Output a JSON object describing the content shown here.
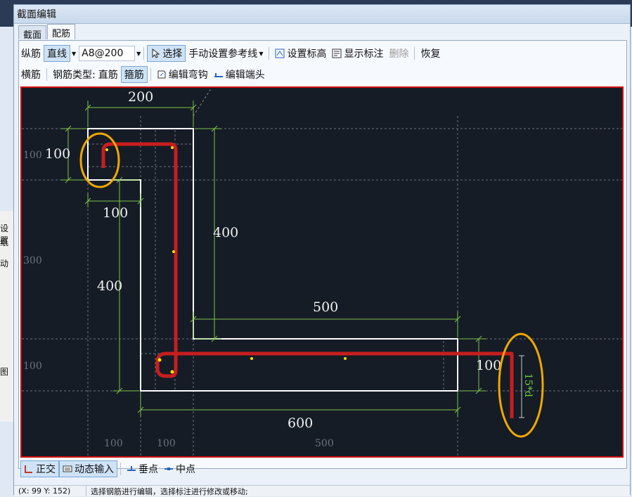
{
  "window": {
    "title": "截面编辑"
  },
  "tabs": [
    {
      "label": "截面"
    },
    {
      "label": "配筋"
    }
  ],
  "toolbar1": {
    "longitudinal": "纵筋",
    "straight": "直线",
    "spec_value": "A8@200",
    "select": "选择",
    "manual_ref": "手动设置参考线",
    "set_elev": "设置标高",
    "show_label": "显示标注",
    "delete": "删除",
    "restore": "恢复"
  },
  "toolbar2": {
    "transverse": "横筋",
    "rebar_type_label": "钢筋类型:",
    "straight_bar": "直筋",
    "stirrup": "箍筋",
    "edit_hook": "编辑弯钩",
    "edit_end": "编辑端头"
  },
  "bottom": {
    "ortho": "正交",
    "dynamic_input": "动态输入",
    "perpendicular": "垂点",
    "midpoint": "中点"
  },
  "status": {
    "coords": "(X: 99 Y: 152)",
    "hint": "选择钢筋进行编辑，选择标注进行修改或移动;"
  },
  "drawing": {
    "dims": {
      "top_width": "200",
      "left_height": "100",
      "inner_width": "100",
      "right_height": "400",
      "left_long": "400",
      "upper_right": "500",
      "bottom": "600",
      "end_height": "100",
      "anchor": "15*d"
    },
    "ghost": {
      "g100a": "100",
      "g300": "300",
      "g100b": "100",
      "gx100a": "100",
      "gx100b": "100",
      "gx500": "500"
    }
  },
  "left_strip": {
    "t1": "设置",
    "t2": "纸",
    "t3": "动",
    "t4": "图"
  },
  "colors": {
    "rebar": "#c81e1e",
    "outline": "#ffffff",
    "dim": "#7fc24a",
    "highlight": "#f0a800",
    "canvas_bg": "#151c26"
  }
}
